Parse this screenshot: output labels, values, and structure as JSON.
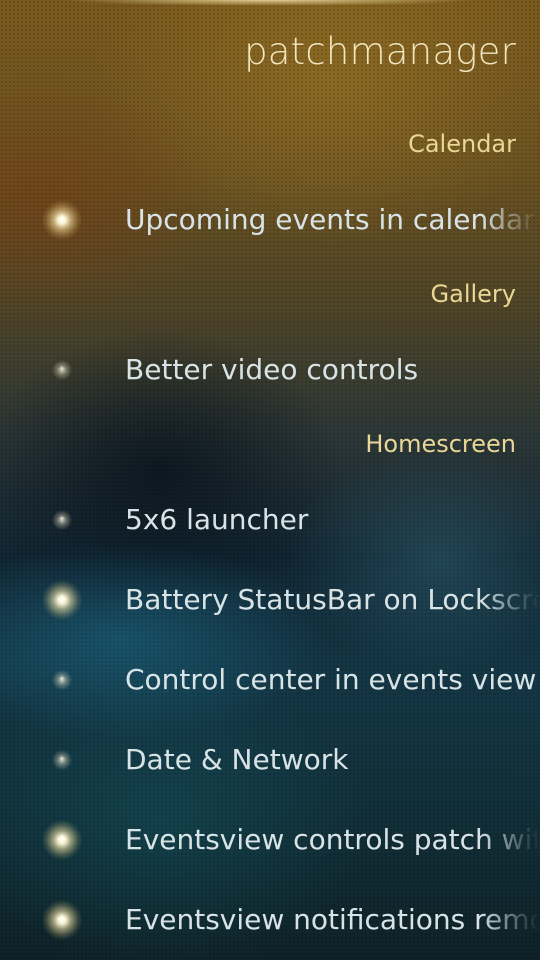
{
  "page": {
    "title": "patchmanager"
  },
  "sections": [
    {
      "header": "Calendar",
      "items": [
        {
          "label": "Upcoming events in calendar cover",
          "enabled": true
        }
      ]
    },
    {
      "header": "Gallery",
      "items": [
        {
          "label": "Better video controls",
          "enabled": false
        }
      ]
    },
    {
      "header": "Homescreen",
      "items": [
        {
          "label": "5x6 launcher",
          "enabled": false
        },
        {
          "label": "Battery StatusBar on Lockscreen",
          "enabled": true
        },
        {
          "label": "Control center in events view",
          "enabled": false
        },
        {
          "label": "Date & Network",
          "enabled": false
        },
        {
          "label": "Eventsview controls patch with",
          "enabled": true
        },
        {
          "label": "Eventsview notifications remove",
          "enabled": true
        }
      ]
    }
  ],
  "icons": {
    "switch_indicator": "glow-dot-icon"
  },
  "colors": {
    "title": "#f2e6bf",
    "section_header": "#e9d795",
    "item_label": "#d8e3e6"
  }
}
